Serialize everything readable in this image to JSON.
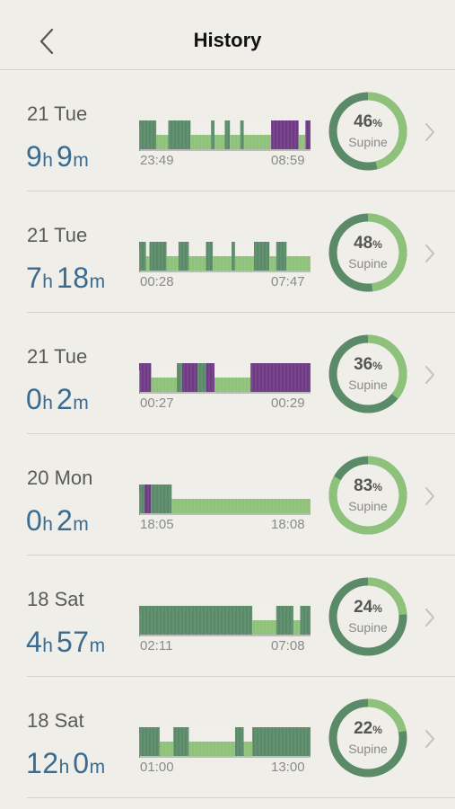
{
  "header": {
    "title": "History"
  },
  "colors": {
    "dark_green": "#5a8a68",
    "light_green": "#8ec27a",
    "purple": "#6f3b85",
    "ring_dark": "#5a8a68",
    "ring_light": "#8ec27a",
    "duration_blue": "#3b6b90"
  },
  "entries": [
    {
      "day": "21 Tue",
      "hours": "9",
      "minutes": "9",
      "h_unit": "h",
      "m_unit": "m",
      "start": "23:49",
      "end": "08:59",
      "percent": "46",
      "percent_value": 46,
      "label": "Supine",
      "segments": [
        [
          "d",
          0,
          0.1
        ],
        [
          "l",
          0.1,
          0.17
        ],
        [
          "d",
          0.17,
          0.3
        ],
        [
          "l",
          0.3,
          0.42
        ],
        [
          "d",
          0.42,
          0.44
        ],
        [
          "l",
          0.44,
          0.5
        ],
        [
          "d",
          0.5,
          0.53
        ],
        [
          "l",
          0.53,
          0.59
        ],
        [
          "d",
          0.59,
          0.61
        ],
        [
          "l",
          0.61,
          0.77
        ],
        [
          "p",
          0.77,
          0.93
        ],
        [
          "l",
          0.93,
          0.97
        ],
        [
          "p",
          0.97,
          1
        ]
      ]
    },
    {
      "day": "21 Tue",
      "hours": "7",
      "minutes": "18",
      "h_unit": "h",
      "m_unit": "m",
      "start": "00:28",
      "end": "07:47",
      "percent": "48",
      "percent_value": 48,
      "label": "Supine",
      "segments": [
        [
          "d",
          0,
          0.04
        ],
        [
          "l",
          0.04,
          0.06
        ],
        [
          "d",
          0.06,
          0.16
        ],
        [
          "l",
          0.16,
          0.23
        ],
        [
          "d",
          0.23,
          0.29
        ],
        [
          "l",
          0.29,
          0.39
        ],
        [
          "d",
          0.39,
          0.43
        ],
        [
          "l",
          0.43,
          0.54
        ],
        [
          "d",
          0.54,
          0.56
        ],
        [
          "l",
          0.56,
          0.67
        ],
        [
          "d",
          0.67,
          0.76
        ],
        [
          "l",
          0.76,
          0.8
        ],
        [
          "d",
          0.8,
          0.86
        ],
        [
          "l",
          0.86,
          1
        ]
      ]
    },
    {
      "day": "21 Tue",
      "hours": "0",
      "minutes": "2",
      "h_unit": "h",
      "m_unit": "m",
      "start": "00:27",
      "end": "00:29",
      "percent": "36",
      "percent_value": 36,
      "label": "Supine",
      "segments": [
        [
          "p",
          0,
          0.07
        ],
        [
          "l",
          0.07,
          0.22
        ],
        [
          "d",
          0.22,
          0.25
        ],
        [
          "p",
          0.25,
          0.34
        ],
        [
          "d",
          0.34,
          0.39
        ],
        [
          "p",
          0.39,
          0.44
        ],
        [
          "l",
          0.44,
          0.65
        ],
        [
          "p",
          0.65,
          1
        ]
      ]
    },
    {
      "day": "20 Mon",
      "hours": "0",
      "minutes": "2",
      "h_unit": "h",
      "m_unit": "m",
      "start": "18:05",
      "end": "18:08",
      "percent": "83",
      "percent_value": 83,
      "label": "Supine",
      "segments": [
        [
          "d",
          0,
          0.03
        ],
        [
          "p",
          0.03,
          0.07
        ],
        [
          "d",
          0.07,
          0.19
        ],
        [
          "l",
          0.19,
          1
        ]
      ]
    },
    {
      "day": "18 Sat",
      "hours": "4",
      "minutes": "57",
      "h_unit": "h",
      "m_unit": "m",
      "start": "02:11",
      "end": "07:08",
      "percent": "24",
      "percent_value": 24,
      "label": "Supine",
      "segments": [
        [
          "d",
          0,
          0.66
        ],
        [
          "l",
          0.66,
          0.8
        ],
        [
          "d",
          0.8,
          0.9
        ],
        [
          "l",
          0.9,
          0.94
        ],
        [
          "d",
          0.94,
          1
        ]
      ]
    },
    {
      "day": "18 Sat",
      "hours": "12",
      "minutes": "0",
      "h_unit": "h",
      "m_unit": "m",
      "start": "01:00",
      "end": "13:00",
      "percent": "22",
      "percent_value": 22,
      "label": "Supine",
      "segments": [
        [
          "d",
          0,
          0.12
        ],
        [
          "l",
          0.12,
          0.2
        ],
        [
          "d",
          0.2,
          0.29
        ],
        [
          "l",
          0.29,
          0.56
        ],
        [
          "d",
          0.56,
          0.61
        ],
        [
          "l",
          0.61,
          0.66
        ],
        [
          "d",
          0.66,
          1
        ]
      ]
    }
  ]
}
